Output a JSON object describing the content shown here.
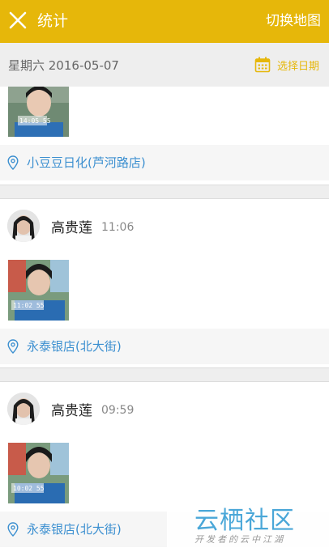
{
  "header": {
    "title": "统计",
    "action": "切换地图"
  },
  "datebar": {
    "date": "星期六  2016-05-07",
    "pick_label": "选择日期"
  },
  "records": [
    {
      "location": "小豆豆日化(芦河路店)"
    },
    {
      "name": "高贵莲",
      "time": "11:06",
      "location": "永泰银店(北大街)"
    },
    {
      "name": "高贵莲",
      "time": "09:59",
      "location": "永泰银店(北大街)"
    }
  ],
  "watermark": {
    "title": "云栖社区",
    "subtitle": "开发者的云中江湖"
  },
  "colors": {
    "accent": "#e6b70a",
    "link": "#3b8fd0",
    "background": "#eeeeee"
  },
  "icons": [
    "close-icon",
    "calendar-icon",
    "location-pin-icon"
  ]
}
